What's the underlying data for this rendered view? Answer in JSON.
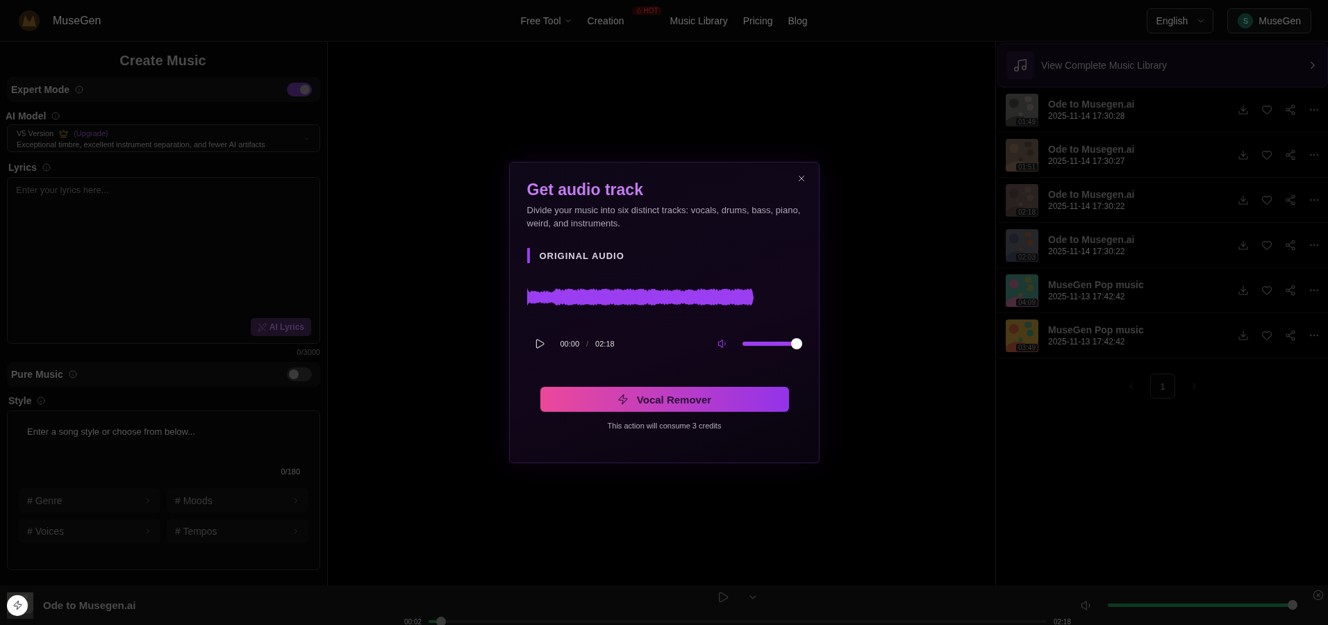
{
  "header": {
    "brand": "MuseGen",
    "nav": [
      {
        "label": "Free Tool",
        "kind": "dropdown"
      },
      {
        "label": "Creation",
        "kind": "badge",
        "badge": "HOT"
      },
      {
        "label": "Music Library",
        "kind": "link"
      },
      {
        "label": "Pricing",
        "kind": "link"
      },
      {
        "label": "Blog",
        "kind": "link"
      }
    ],
    "language": "English",
    "account": {
      "initial": "S",
      "name": "MuseGen"
    }
  },
  "create_panel": {
    "title": "Create Music",
    "expert_mode": {
      "label": "Expert Mode",
      "on": true
    },
    "ai_model": {
      "label": "AI Model",
      "version": "V5 Version",
      "upgrade": "(Upgrade)",
      "description": "Exceptional timbre, excellent instrument separation, and fewer AI artifacts"
    },
    "lyrics": {
      "label": "Lyrics",
      "placeholder": "Enter your lyrics here...",
      "button": "AI Lyrics",
      "counter": "0/3000"
    },
    "pure_music": {
      "label": "Pure Music",
      "on": false
    },
    "style": {
      "label": "Style",
      "placeholder": "Enter a song style or choose from below...",
      "counter": "0/180",
      "chips": [
        "# Genre",
        "# Moods",
        "# Voices",
        "# Tempos"
      ]
    }
  },
  "modal": {
    "title": "Get audio track",
    "description": "Divide your music into six distinct tracks: vocals, drums, bass, piano, weird, and instruments.",
    "section": "ORIGINAL AUDIO",
    "current_time": "00:00",
    "separator": "/",
    "duration": "02:18",
    "volume": {
      "level": 1
    },
    "button": "Vocal Remover",
    "note": "This action will consume 3 credits"
  },
  "library": {
    "header": "View Complete Music Library",
    "tracks": [
      {
        "title": "Ode to Musegen.ai",
        "date": "2025-11-14 17:30:28",
        "duration": "01:49"
      },
      {
        "title": "Ode to Musegen.ai",
        "date": "2025-11-14 17:30:27",
        "duration": "01:51"
      },
      {
        "title": "Ode to Musegen.ai",
        "date": "2025-11-14 17:30:22",
        "duration": "02:18"
      },
      {
        "title": "Ode to Musegen.ai",
        "date": "2025-11-14 17:30:22",
        "duration": "02:03"
      },
      {
        "title": "MuseGen Pop music",
        "date": "2025-11-13 17:42:42",
        "duration": "04:09"
      },
      {
        "title": "MuseGen Pop music",
        "date": "2025-11-13 17:42:42",
        "duration": "03:49"
      }
    ],
    "pages": [
      {
        "label": "1",
        "selected": true
      }
    ]
  },
  "player": {
    "title": "Ode to Musegen.ai",
    "elapsed": "00:02",
    "total": "02:18",
    "progress": {
      "level": 0.02
    },
    "volume": {
      "level": 1
    }
  }
}
